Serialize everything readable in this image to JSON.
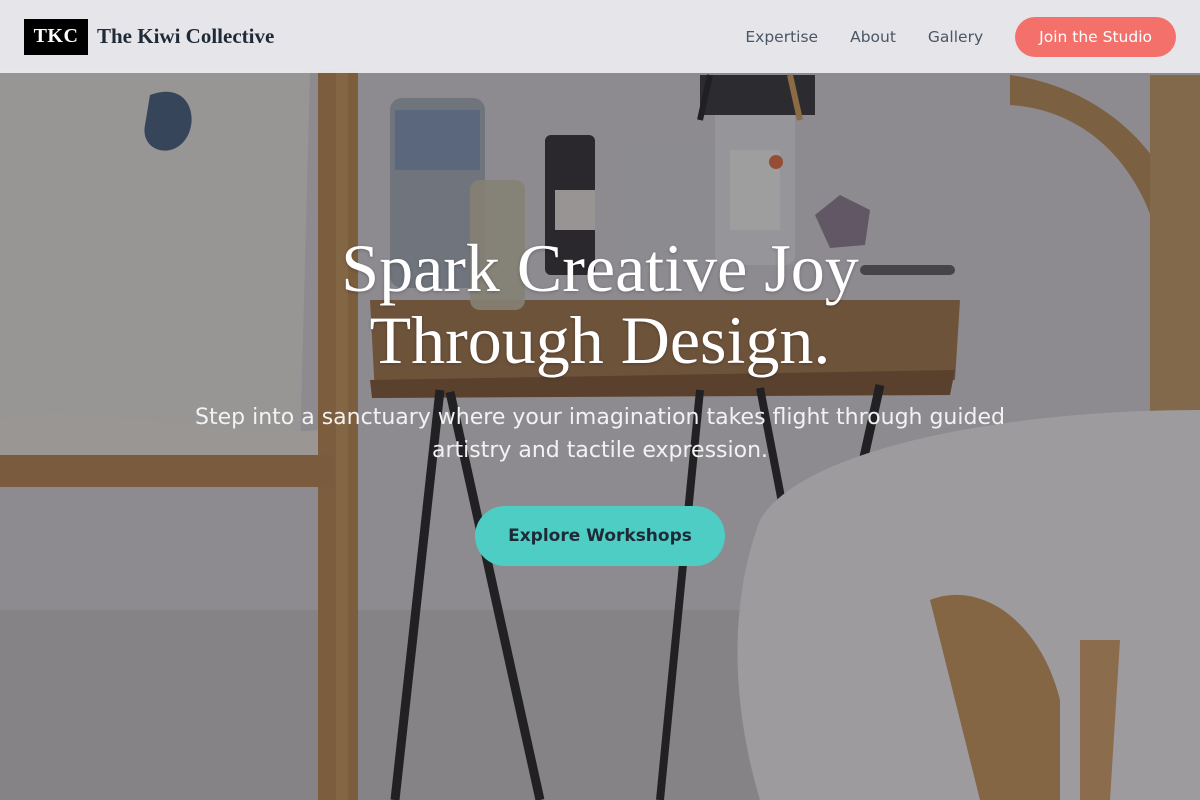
{
  "header": {
    "logo_text": "TKC",
    "brand_name": "The Kiwi Collective",
    "nav": [
      "Expertise",
      "About",
      "Gallery"
    ],
    "cta_label": "Join the Studio"
  },
  "hero": {
    "headline_line1": "Spark Creative Joy",
    "headline_line2": "Through Design.",
    "subtitle_line1": "Step into a sanctuary where your imagination takes flight through guided",
    "subtitle_line2": "artistry and tactile expression.",
    "button_label": "Explore Workshops",
    "background_image": "art-studio-table-with-jars-and-brushes"
  },
  "colors": {
    "cta": "#f4716b",
    "primary_button": "#4ecdc4",
    "header_bg": "#ececef",
    "text_dark": "#1f2a37"
  }
}
